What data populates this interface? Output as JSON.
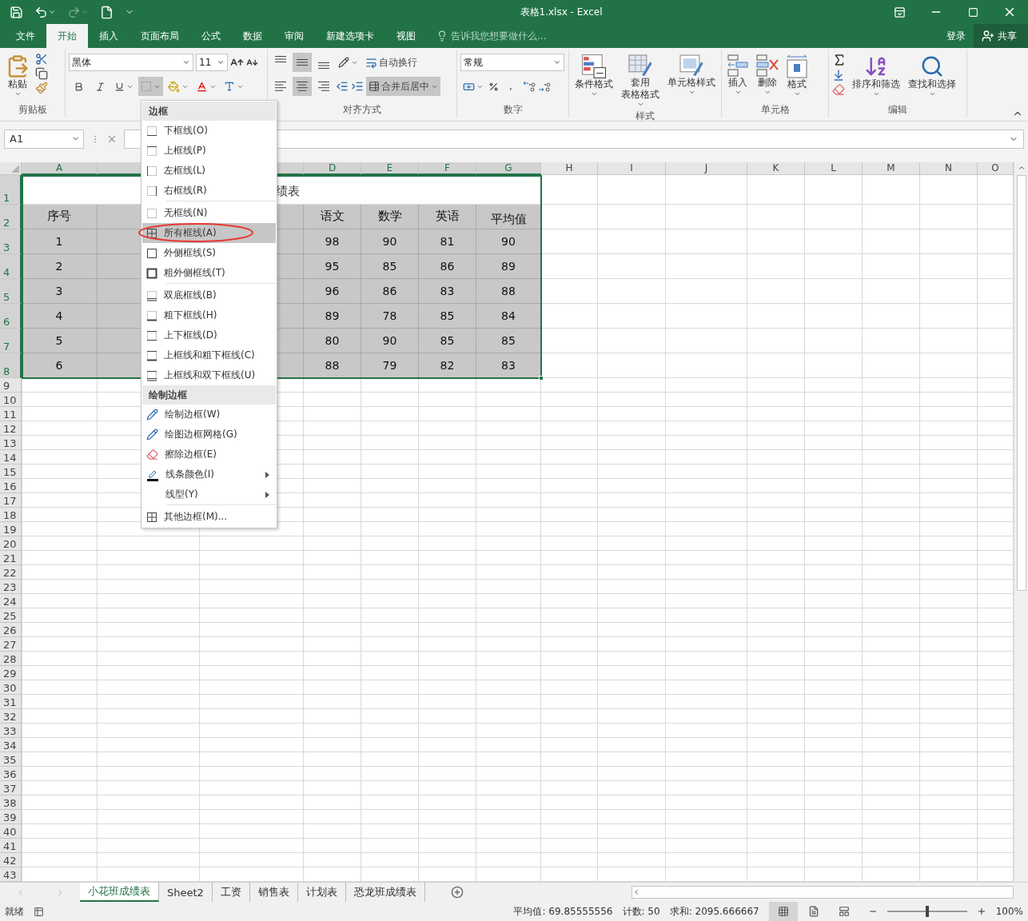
{
  "window": {
    "title": "表格1.xlsx - Excel"
  },
  "menu_tabs": [
    {
      "label": "文件",
      "selected": false
    },
    {
      "label": "开始",
      "selected": true
    },
    {
      "label": "插入",
      "selected": false
    },
    {
      "label": "页面布局",
      "selected": false
    },
    {
      "label": "公式",
      "selected": false
    },
    {
      "label": "数据",
      "selected": false
    },
    {
      "label": "审阅",
      "selected": false
    },
    {
      "label": "新建选项卡",
      "selected": false
    },
    {
      "label": "视图",
      "selected": false
    }
  ],
  "tell_me": {
    "placeholder": "告诉我您想要做什么..."
  },
  "account": {
    "sign_in": "登录",
    "share": "共享"
  },
  "ribbon": {
    "clipboard": {
      "paste": "粘贴",
      "label": "剪贴板"
    },
    "font": {
      "font_name": "黑体",
      "font_size": "11",
      "border_button": {
        "pressed": true
      }
    },
    "alignment": {
      "vertical": [
        {
          "kind": "top",
          "selected": false
        },
        {
          "kind": "middle",
          "selected": true
        },
        {
          "kind": "bottom",
          "selected": false
        }
      ],
      "horizontal": [
        {
          "kind": "left",
          "selected": false
        },
        {
          "kind": "center",
          "selected": true
        },
        {
          "kind": "right",
          "selected": false
        }
      ],
      "wrap_text": "自动换行",
      "merge": {
        "label": "合并后居中",
        "selected": true
      },
      "label": "对齐方式"
    },
    "number": {
      "format": "常规",
      "comma": ",",
      "label": "数字"
    },
    "styles": {
      "label": "样式",
      "buttons": [
        {
          "lines": [
            "条件格式"
          ],
          "kind": "conditional"
        },
        {
          "lines": [
            "套用",
            "表格格式"
          ],
          "kind": "table"
        },
        {
          "lines": [
            "单元格样式"
          ],
          "kind": "cell"
        }
      ]
    },
    "cells": {
      "label": "单元格",
      "buttons": [
        {
          "lines": [
            "插入"
          ],
          "kind": "insert"
        },
        {
          "lines": [
            "删除"
          ],
          "kind": "delete"
        },
        {
          "lines": [
            "格式"
          ],
          "kind": "format"
        }
      ]
    },
    "editing": {
      "label": "编辑",
      "buttons": [
        {
          "lines": [
            "排序和筛选"
          ],
          "kind": "sort"
        },
        {
          "lines": [
            "查找和选择"
          ],
          "kind": "find"
        }
      ]
    }
  },
  "formula_bar": {
    "name_box": "A1"
  },
  "columns": [
    {
      "label": "A",
      "selected": true
    },
    {
      "selected": true
    },
    {
      "selected": true
    },
    {
      "label": "D",
      "selected": true
    },
    {
      "label": "E",
      "selected": true
    },
    {
      "label": "F",
      "selected": true
    },
    {
      "label": "G",
      "selected": true
    },
    {
      "label": "H",
      "selected": false
    },
    {
      "label": "I",
      "selected": false
    },
    {
      "label": "J",
      "selected": false
    },
    {
      "label": "K",
      "selected": false
    },
    {
      "label": "L",
      "selected": false
    },
    {
      "label": "M",
      "selected": false
    },
    {
      "label": "N",
      "selected": false
    },
    {
      "label": "O",
      "selected": false
    }
  ],
  "row_numbers": [
    {
      "label": "1",
      "selected": true
    },
    {
      "label": "2",
      "selected": true
    },
    {
      "label": "3",
      "selected": true
    },
    {
      "label": "4",
      "selected": true
    },
    {
      "label": "5",
      "selected": true
    },
    {
      "label": "6",
      "selected": true
    },
    {
      "label": "7",
      "selected": true
    },
    {
      "label": "8",
      "selected": true
    },
    {
      "label": "9",
      "selected": false
    },
    {
      "label": "10",
      "selected": false
    },
    {
      "label": "11",
      "selected": false
    },
    {
      "label": "12",
      "selected": false
    },
    {
      "label": "13",
      "selected": false
    },
    {
      "label": "14",
      "selected": false
    },
    {
      "label": "15",
      "selected": false
    },
    {
      "label": "16",
      "selected": false
    },
    {
      "label": "17",
      "selected": false
    },
    {
      "label": "18",
      "selected": false
    },
    {
      "label": "19",
      "selected": false
    },
    {
      "label": "20",
      "selected": false
    },
    {
      "label": "21",
      "selected": false
    },
    {
      "label": "22",
      "selected": false
    },
    {
      "label": "23",
      "selected": false
    },
    {
      "label": "24",
      "selected": false
    },
    {
      "label": "25",
      "selected": false
    },
    {
      "label": "26",
      "selected": false
    },
    {
      "label": "27",
      "selected": false
    },
    {
      "label": "28",
      "selected": false
    },
    {
      "label": "29",
      "selected": false
    },
    {
      "label": "30",
      "selected": false
    },
    {
      "label": "31",
      "selected": false
    },
    {
      "label": "32",
      "selected": false
    },
    {
      "label": "33",
      "selected": false
    },
    {
      "label": "34",
      "selected": false
    },
    {
      "label": "35",
      "selected": false
    },
    {
      "label": "36",
      "selected": false
    },
    {
      "label": "37",
      "selected": false
    },
    {
      "label": "38",
      "selected": false
    },
    {
      "label": "39",
      "selected": false
    },
    {
      "label": "40",
      "selected": false
    },
    {
      "label": "41",
      "selected": false
    },
    {
      "label": "42",
      "selected": false
    },
    {
      "label": "43",
      "selected": false
    }
  ],
  "table": {
    "title": "绩表",
    "header": {
      "A": "序号",
      "D": "语文",
      "E": "数学",
      "F": "英语",
      "G": "平均值"
    },
    "rows": [
      {
        "A": "1",
        "D": "98",
        "E": "90",
        "F": "81",
        "G": "90"
      },
      {
        "A": "2",
        "D": "95",
        "E": "85",
        "F": "86",
        "G": "89"
      },
      {
        "A": "3",
        "D": "96",
        "E": "86",
        "F": "83",
        "G": "88"
      },
      {
        "A": "4",
        "D": "89",
        "E": "78",
        "F": "85",
        "G": "84"
      },
      {
        "A": "5",
        "D": "80",
        "E": "90",
        "F": "85",
        "G": "85"
      },
      {
        "A": "6",
        "D": "88",
        "E": "79",
        "F": "82",
        "G": "83"
      }
    ]
  },
  "border_menu": {
    "sections": [
      {
        "title": "边框",
        "items": [
          {
            "label": "下框线(O)",
            "kind": "bottom",
            "highlighted": false
          },
          {
            "label": "上框线(P)",
            "kind": "top",
            "highlighted": false
          },
          {
            "label": "左框线(L)",
            "kind": "left",
            "highlighted": false
          },
          {
            "label": "右框线(R)",
            "kind": "right",
            "highlighted": false
          },
          {
            "label": "无框线(N)",
            "kind": "none",
            "highlighted": false,
            "separator_before": true
          },
          {
            "label": "所有框线(A)",
            "kind": "all",
            "highlighted": true,
            "annotated": true
          },
          {
            "label": "外侧框线(S)",
            "kind": "outside",
            "highlighted": false
          },
          {
            "label": "粗外侧框线(T)",
            "kind": "thick-outside",
            "highlighted": false
          },
          {
            "label": "双底框线(B)",
            "kind": "double-bottom",
            "highlighted": false,
            "separator_before": true
          },
          {
            "label": "粗下框线(H)",
            "kind": "thick-bottom",
            "highlighted": false
          },
          {
            "label": "上下框线(D)",
            "kind": "top-bottom",
            "highlighted": false
          },
          {
            "label": "上框线和粗下框线(C)",
            "kind": "top-thick-bottom",
            "highlighted": false
          },
          {
            "label": "上框线和双下框线(U)",
            "kind": "top-double-bottom",
            "highlighted": false
          }
        ]
      },
      {
        "title": "绘制边框",
        "items": [
          {
            "label": "绘制边框(W)",
            "kind": "draw",
            "highlighted": false
          },
          {
            "label": "绘图边框网格(G)",
            "kind": "draw-grid",
            "highlighted": false
          },
          {
            "label": "擦除边框(E)",
            "kind": "erase",
            "highlighted": false
          },
          {
            "label": "线条颜色(I)",
            "kind": "line-color",
            "highlighted": false,
            "submenu": true
          },
          {
            "label": "线型(Y)",
            "kind": "line-style",
            "highlighted": false,
            "submenu": true
          },
          {
            "label": "其他边框(M)...",
            "kind": "more",
            "highlighted": false,
            "separator_before": true
          }
        ]
      }
    ]
  },
  "sheet_tabs": [
    {
      "label": "小花班成绩表",
      "selected": true
    },
    {
      "label": "Sheet2",
      "selected": false
    },
    {
      "label": "工资",
      "selected": false
    },
    {
      "label": "销售表",
      "selected": false
    },
    {
      "label": "计划表",
      "selected": false
    },
    {
      "label": "恐龙班成绩表",
      "selected": false
    }
  ],
  "status_bar": {
    "status": "就绪",
    "average": "平均值: 69.85555556",
    "count": "计数: 50",
    "sum": "求和: 2095.666667",
    "views": [
      {
        "kind": "normal",
        "selected": true
      },
      {
        "kind": "page-layout",
        "selected": false
      },
      {
        "kind": "page-break",
        "selected": false
      }
    ],
    "zoom": {
      "level": 0.5,
      "reading": "100%"
    }
  }
}
